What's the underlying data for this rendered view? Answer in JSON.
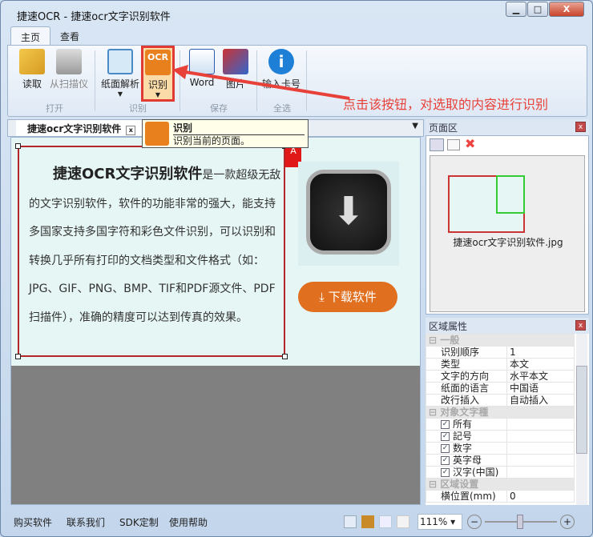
{
  "window": {
    "title": "捷速OCR - 捷速ocr文字识别软件",
    "min": "▁",
    "max": "□",
    "close": "X"
  },
  "tabs": [
    {
      "label": "主页"
    },
    {
      "label": "查看"
    }
  ],
  "ribbon": {
    "buttons": [
      {
        "label": "读取"
      },
      {
        "label": "从扫描仪"
      },
      {
        "label": "纸面解析"
      },
      {
        "label": "识别"
      },
      {
        "label": "Word"
      },
      {
        "label": "图片"
      },
      {
        "label": "输入卡号"
      }
    ],
    "groups": [
      {
        "label": "打开"
      },
      {
        "label": "识别"
      },
      {
        "label": "保存"
      },
      {
        "label": "全选"
      }
    ],
    "ocr_icon_text": "OCR"
  },
  "annotation": "点击该按钮，对选取的内容进行识别",
  "tooltip": {
    "title": "识别",
    "desc": "识别当前的页面。"
  },
  "doc": {
    "tab_label": "捷速ocr文字识别软件",
    "title_bold": "捷速OCR文字识别软件",
    "body": "是一款超级无敌的文字识别软件，软件的功能非常的强大，能支持多国家支持多国字符和彩色文件识别，可以识别和转换几乎所有打印的文档类型和文件格式（如：JPG、GIF、PNG、BMP、TIF和PDF源文件、PDF扫描件），准确的精度可以达到传真的效果。",
    "download_label": "下载软件",
    "zone_marker": "A"
  },
  "page_pane": {
    "title": "页面区",
    "thumb_label": "捷速ocr文字识别软件.jpg"
  },
  "props": {
    "title": "区域属性",
    "general": {
      "label": "一般",
      "rows": [
        {
          "k": "识别顺序",
          "v": "1"
        },
        {
          "k": "类型",
          "v": "本文"
        },
        {
          "k": "文字的方向",
          "v": "水平本文"
        },
        {
          "k": "纸面的语言",
          "v": "中国语"
        },
        {
          "k": "改行插入",
          "v": "自动插入"
        }
      ]
    },
    "chars": {
      "label": "对象文字種",
      "rows": [
        {
          "k": "所有",
          "checked": true
        },
        {
          "k": "記号",
          "checked": true
        },
        {
          "k": "数字",
          "checked": true
        },
        {
          "k": "英字母",
          "checked": true
        },
        {
          "k": "汉字(中国)",
          "checked": true
        }
      ]
    },
    "area": {
      "label": "区域设置",
      "rows": [
        {
          "k": "横位置(mm)",
          "v": "0"
        }
      ]
    }
  },
  "status": {
    "links": [
      "购买软件",
      "联系我们",
      "SDK定制",
      "使用帮助"
    ],
    "zoom": "111%"
  },
  "colors": {
    "accent_red": "#e8413a",
    "ocr_orange": "#e8801e",
    "download_orange": "#e07020"
  }
}
